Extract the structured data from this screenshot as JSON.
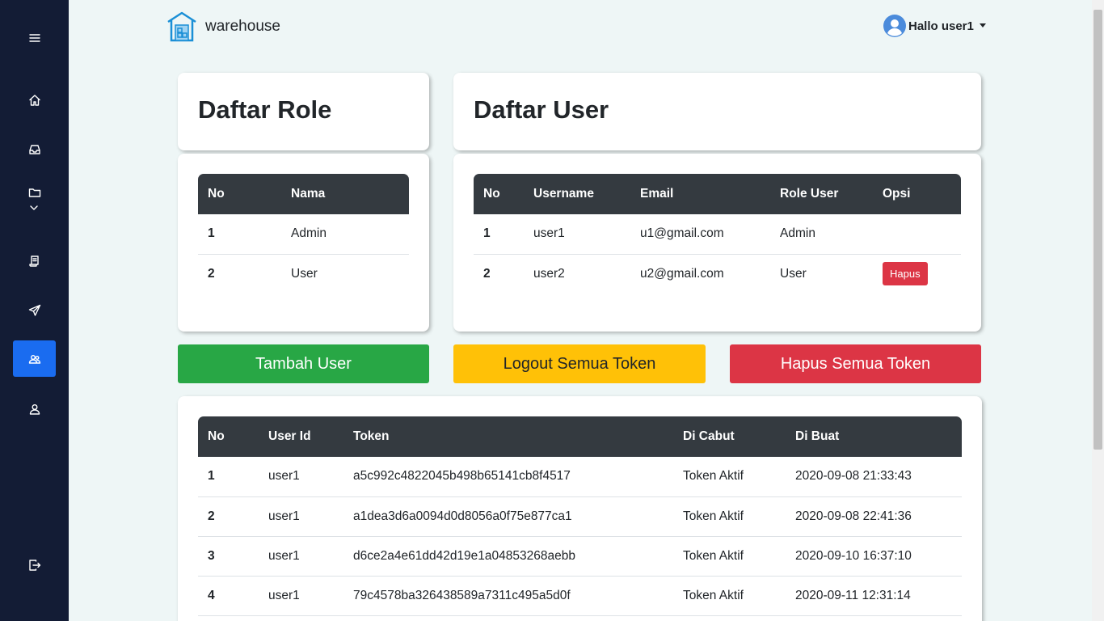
{
  "sidebar": {
    "items": [
      {
        "icon": "menu-icon"
      },
      {
        "icon": "home-icon"
      },
      {
        "icon": "inbox-icon"
      },
      {
        "icon": "folder-icon"
      },
      {
        "icon": "receipt-icon"
      },
      {
        "icon": "send-icon"
      },
      {
        "icon": "users-icon",
        "active": true
      },
      {
        "icon": "user-icon"
      },
      {
        "icon": "logout-icon"
      }
    ],
    "background": "#131c35",
    "active_color": "#1a6cf0"
  },
  "header": {
    "brand": "warehouse",
    "user_greeting": "Hallo user1"
  },
  "role_card": {
    "title": "Daftar Role",
    "columns": [
      "No",
      "Nama"
    ],
    "rows": [
      {
        "no": "1",
        "nama": "Admin"
      },
      {
        "no": "2",
        "nama": "User"
      }
    ]
  },
  "user_card": {
    "title": "Daftar User",
    "columns": [
      "No",
      "Username",
      "Email",
      "Role User",
      "Opsi"
    ],
    "rows": [
      {
        "no": "1",
        "username": "user1",
        "email": "u1@gmail.com",
        "role": "Admin",
        "opsi": ""
      },
      {
        "no": "2",
        "username": "user2",
        "email": "u2@gmail.com",
        "role": "User",
        "opsi": "Hapus"
      }
    ]
  },
  "actions": {
    "add_user": "Tambah User",
    "logout_all": "Logout Semua Token",
    "delete_all": "Hapus Semua Token"
  },
  "token_card": {
    "columns": [
      "No",
      "User Id",
      "Token",
      "Di Cabut",
      "Di Buat"
    ],
    "rows": [
      {
        "no": "1",
        "user_id": "user1",
        "token": "a5c992c4822045b498b65141cb8f4517",
        "revoked": "Token Aktif",
        "created": "2020-09-08 21:33:43"
      },
      {
        "no": "2",
        "user_id": "user1",
        "token": "a1dea3d6a0094d0d8056a0f75e877ca1",
        "revoked": "Token Aktif",
        "created": "2020-09-08 22:41:36"
      },
      {
        "no": "3",
        "user_id": "user1",
        "token": "d6ce2a4e61dd42d19e1a04853268aebb",
        "revoked": "Token Aktif",
        "created": "2020-09-10 16:37:10"
      },
      {
        "no": "4",
        "user_id": "user1",
        "token": "79c4578ba326438589a7311c495a5d0f",
        "revoked": "Token Aktif",
        "created": "2020-09-11 12:31:14"
      }
    ]
  }
}
